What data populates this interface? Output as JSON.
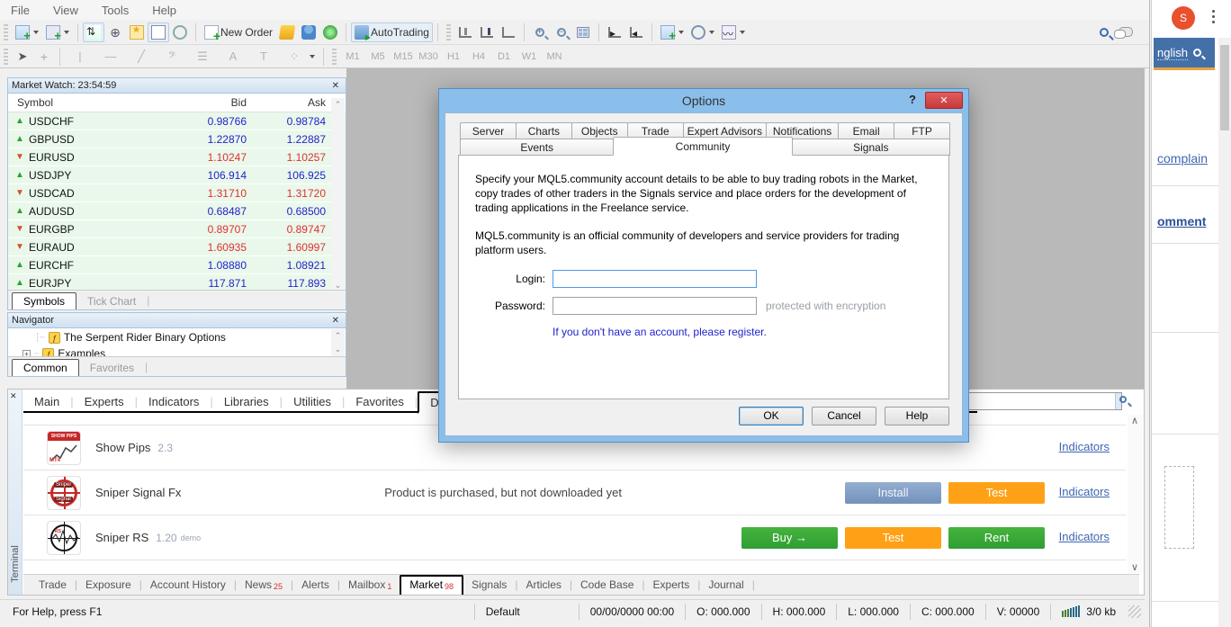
{
  "menu": {
    "items": [
      "File",
      "View",
      "Tools",
      "Help"
    ]
  },
  "toolbar": {
    "new_order_label": "New Order",
    "autotrading_label": "AutoTrading",
    "timeframes": [
      "M1",
      "M5",
      "M15",
      "M30",
      "H1",
      "H4",
      "D1",
      "W1",
      "MN"
    ],
    "text_tool": "A",
    "label_tool": "T"
  },
  "market_watch": {
    "title": "Market Watch: 23:54:59",
    "columns": {
      "symbol": "Symbol",
      "bid": "Bid",
      "ask": "Ask"
    },
    "rows": [
      {
        "symbol": "USDCHF",
        "bid": "0.98766",
        "ask": "0.98784",
        "dir": "up"
      },
      {
        "symbol": "GBPUSD",
        "bid": "1.22870",
        "ask": "1.22887",
        "dir": "up"
      },
      {
        "symbol": "EURUSD",
        "bid": "1.10247",
        "ask": "1.10257",
        "dir": "down"
      },
      {
        "symbol": "USDJPY",
        "bid": "106.914",
        "ask": "106.925",
        "dir": "up"
      },
      {
        "symbol": "USDCAD",
        "bid": "1.31710",
        "ask": "1.31720",
        "dir": "down"
      },
      {
        "symbol": "AUDUSD",
        "bid": "0.68487",
        "ask": "0.68500",
        "dir": "up"
      },
      {
        "symbol": "EURGBP",
        "bid": "0.89707",
        "ask": "0.89747",
        "dir": "down"
      },
      {
        "symbol": "EURAUD",
        "bid": "1.60935",
        "ask": "1.60997",
        "dir": "down"
      },
      {
        "symbol": "EURCHF",
        "bid": "1.08880",
        "ask": "1.08921",
        "dir": "up"
      },
      {
        "symbol": "EURJPY",
        "bid": "117.871",
        "ask": "117.893",
        "dir": "up"
      }
    ],
    "tabs": [
      "Symbols",
      "Tick Chart"
    ]
  },
  "navigator": {
    "title": "Navigator",
    "items": [
      "The Serpent Rider Binary Options",
      "Examples"
    ],
    "tabs": [
      "Common",
      "Favorites"
    ]
  },
  "dialog": {
    "title": "Options",
    "help_glyph": "?",
    "close_glyph": "✕",
    "tabs_row1": [
      "Server",
      "Charts",
      "Objects",
      "Trade",
      "Expert Advisors",
      "Notifications",
      "Email",
      "FTP"
    ],
    "tabs_row2": [
      "Events",
      "Community",
      "Signals"
    ],
    "active_tab": "Community",
    "body_p1": "Specify your MQL5.community account details to be able to buy trading robots in the Market, copy trades of other traders in the Signals service and place orders for the development of trading applications in the Freelance service.",
    "body_p2": "MQL5.community is an official community of developers and service providers for trading platform users.",
    "login_label": "Login:",
    "password_label": "Password:",
    "password_note": "protected with encryption",
    "register_text": "If you don't have an account, please register.",
    "buttons": {
      "ok": "OK",
      "cancel": "Cancel",
      "help": "Help"
    }
  },
  "market_panel": {
    "tabs": [
      "Main",
      "Experts",
      "Indicators",
      "Libraries",
      "Utilities",
      "Favorites",
      "Downloaded"
    ],
    "active_tab": "Downloaded",
    "products": [
      {
        "name": "Show Pips",
        "version": "2.3",
        "link": "Indicators"
      },
      {
        "name": "Sniper Signal Fx",
        "status": "Product is purchased, but not downloaded yet",
        "buttons": [
          "Install",
          "Test"
        ],
        "link": "Indicators"
      },
      {
        "name": "Sniper RS",
        "version": "1.20",
        "badge": "demo",
        "buttons": [
          "Buy  →",
          "Test",
          "Rent"
        ],
        "link": "Indicators"
      }
    ]
  },
  "terminal": {
    "label": "Terminal",
    "tabs": [
      {
        "label": "Trade"
      },
      {
        "label": "Exposure"
      },
      {
        "label": "Account History"
      },
      {
        "label": "News",
        "count": "25"
      },
      {
        "label": "Alerts"
      },
      {
        "label": "Mailbox",
        "count": "1"
      },
      {
        "label": "Market",
        "count": "98"
      },
      {
        "label": "Signals"
      },
      {
        "label": "Articles"
      },
      {
        "label": "Code Base"
      },
      {
        "label": "Experts"
      },
      {
        "label": "Journal"
      }
    ],
    "active_tab": "Market"
  },
  "status_bar": {
    "help": "For Help, press F1",
    "profile": "Default",
    "datetime": "00/00/0000 00:00",
    "open": "O: 000.000",
    "high": "H: 000.000",
    "low": "L: 000.000",
    "close": "C: 000.000",
    "volume": "V: 00000",
    "traffic": "3/0 kb"
  },
  "browser": {
    "avatar_letter": "S",
    "language_partial": "nglish",
    "complain_link": "complain",
    "comment_link_partial": "omment"
  },
  "colors": {
    "dialog_frame": "#8abfec",
    "close_red": "#c83a3a",
    "price_up": "#2222cc",
    "price_down": "#e03030",
    "buy_green": "#2f9e33",
    "test_orange": "#ffa117",
    "install_blue": "#7391bc",
    "link_blue": "#3e67b1",
    "row_green": "#e9f8ea",
    "browser_blue": "#4470a8",
    "browser_accent": "#e8a33d"
  }
}
